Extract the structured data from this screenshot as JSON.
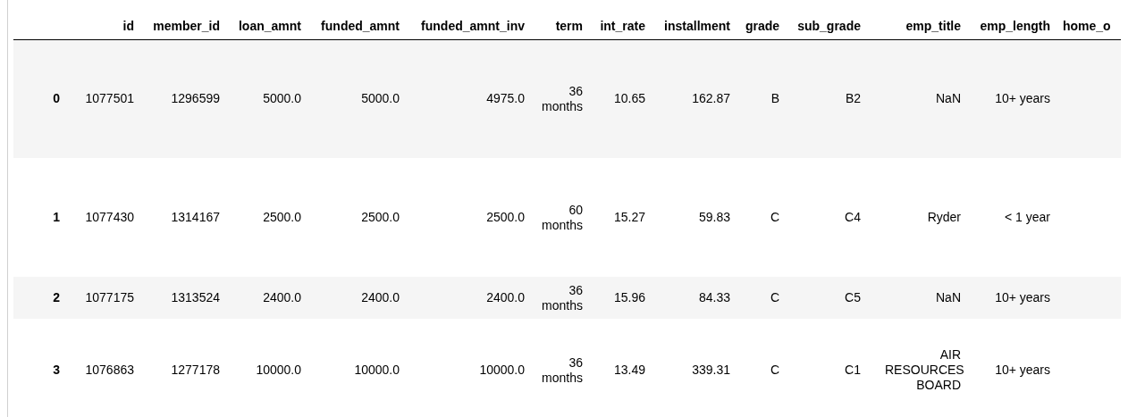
{
  "table": {
    "columns": [
      "id",
      "member_id",
      "loan_amnt",
      "funded_amnt",
      "funded_amnt_inv",
      "term",
      "int_rate",
      "installment",
      "grade",
      "sub_grade",
      "emp_title",
      "emp_length",
      "home_o"
    ],
    "rows": [
      {
        "index": "0",
        "cells": [
          "1077501",
          "1296599",
          "5000.0",
          "5000.0",
          "4975.0",
          "36 months",
          "10.65",
          "162.87",
          "B",
          "B2",
          "NaN",
          "10+ years"
        ]
      },
      {
        "index": "1",
        "cells": [
          "1077430",
          "1314167",
          "2500.0",
          "2500.0",
          "2500.0",
          "60 months",
          "15.27",
          "59.83",
          "C",
          "C4",
          "Ryder",
          "< 1 year"
        ]
      },
      {
        "index": "2",
        "cells": [
          "1077175",
          "1313524",
          "2400.0",
          "2400.0",
          "2400.0",
          "36 months",
          "15.96",
          "84.33",
          "C",
          "C5",
          "NaN",
          "10+ years"
        ]
      },
      {
        "index": "3",
        "cells": [
          "1076863",
          "1277178",
          "10000.0",
          "10000.0",
          "10000.0",
          "36 months",
          "13.49",
          "339.31",
          "C",
          "C1",
          "AIR RESOURCES BOARD",
          "10+ years"
        ]
      }
    ]
  }
}
